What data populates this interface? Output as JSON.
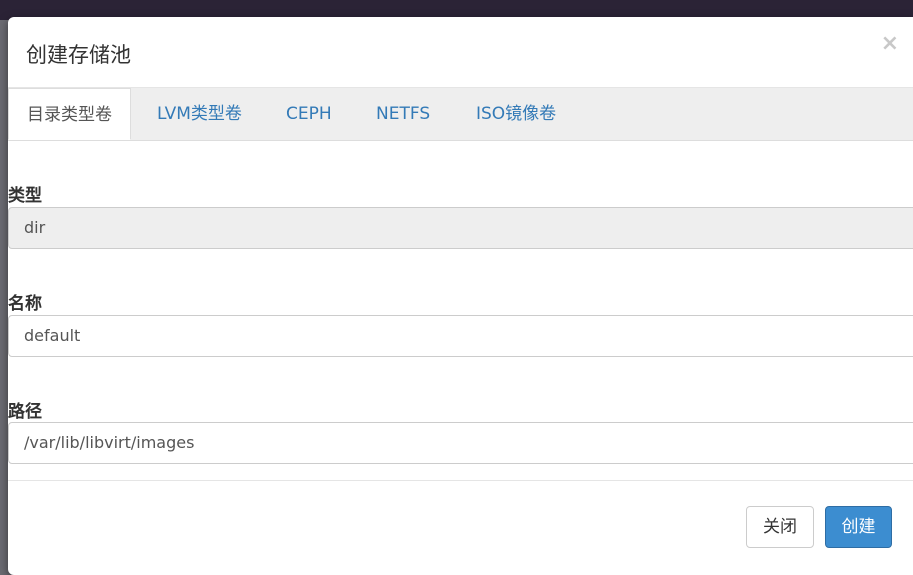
{
  "modal": {
    "title": "创建存储池",
    "close_label": "×"
  },
  "tabs": [
    {
      "label": "目录类型卷",
      "active": true
    },
    {
      "label": "LVM类型卷",
      "active": false
    },
    {
      "label": "CEPH",
      "active": false
    },
    {
      "label": "NETFS",
      "active": false
    },
    {
      "label": "ISO镜像卷",
      "active": false
    }
  ],
  "form": {
    "type_label": "类型",
    "type_value": "dir",
    "name_label": "名称",
    "name_value": "default",
    "path_label": "路径",
    "path_value": "/var/lib/libvirt/images"
  },
  "footer": {
    "close_button": "关闭",
    "create_button": "创建"
  },
  "colors": {
    "primary": "#3c8dd0",
    "link": "#337ab7",
    "backdrop": "#6b6b72"
  }
}
